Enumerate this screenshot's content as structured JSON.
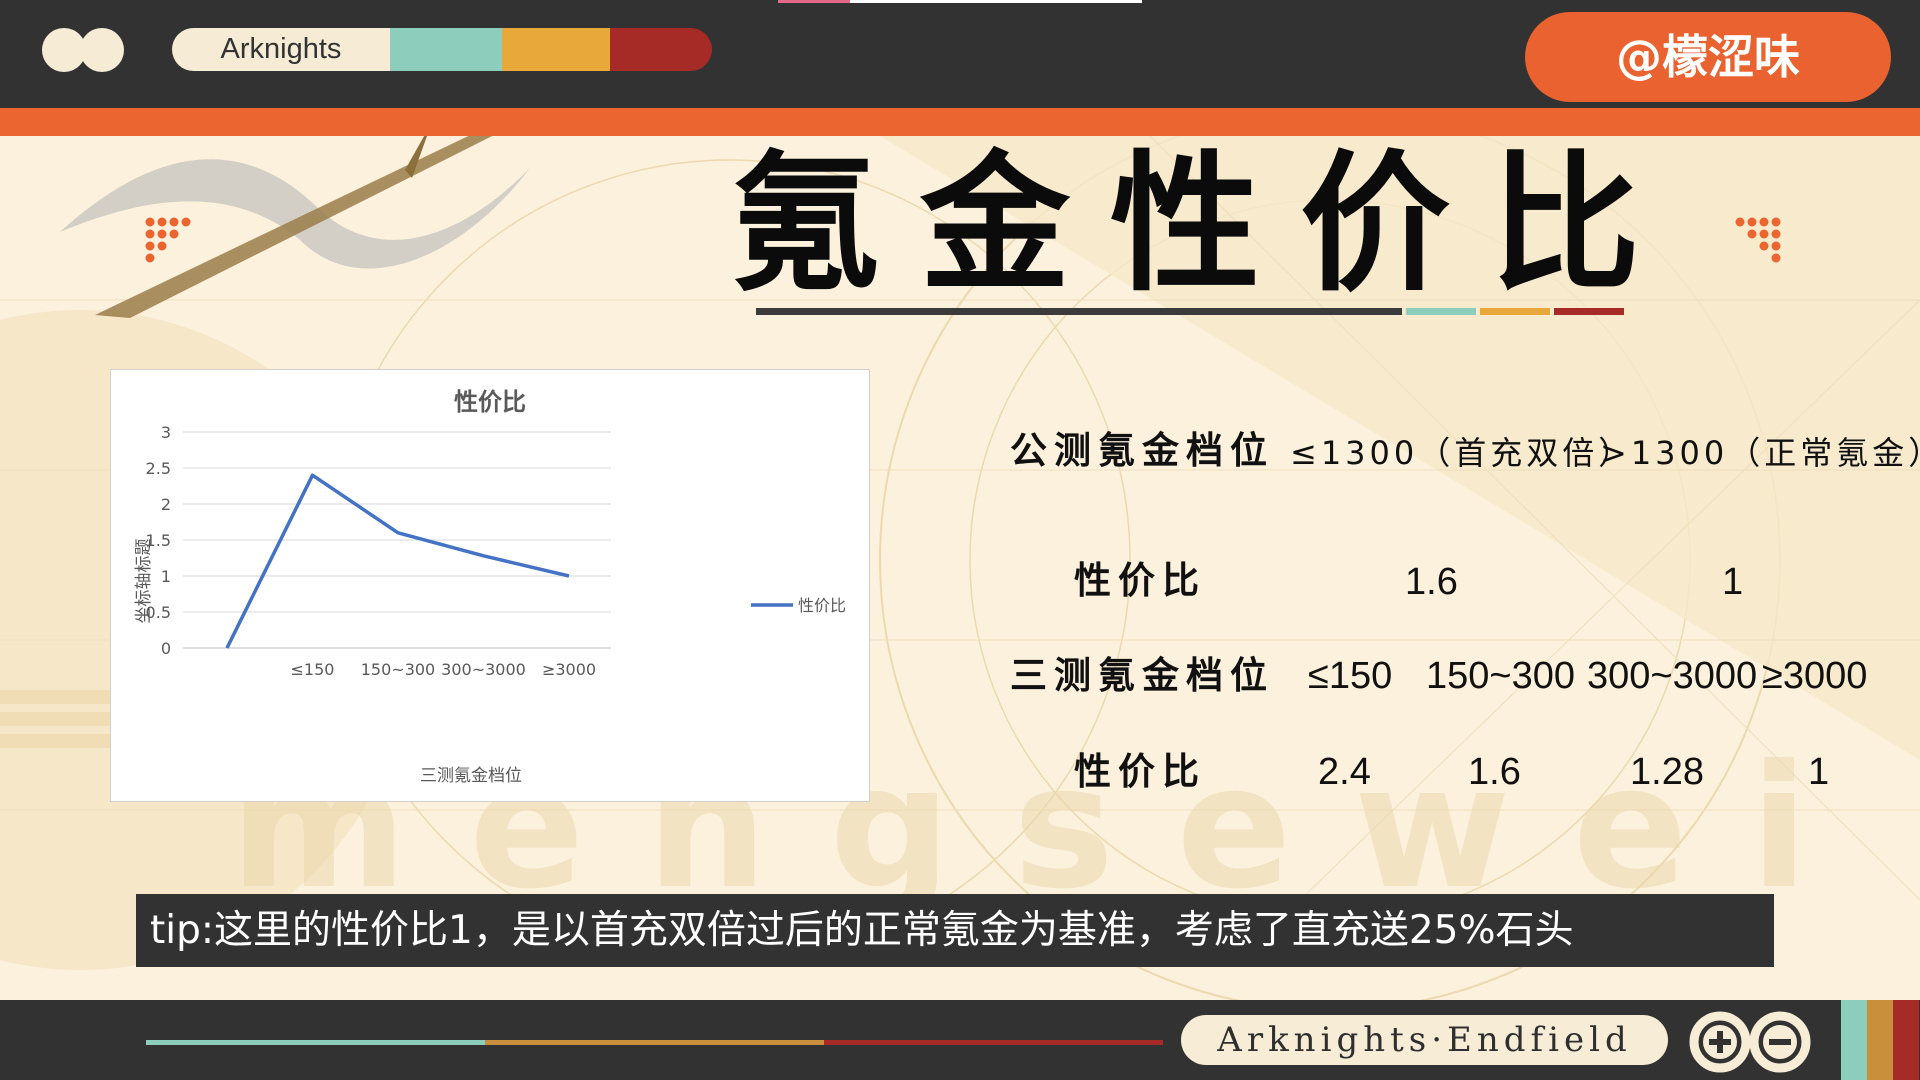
{
  "header": {
    "brand": "Arknights",
    "user": "@檬涩味",
    "pill_colors": [
      "#f6ecd6",
      "#8dcdbb",
      "#e9a93a",
      "#a62a26"
    ]
  },
  "title": {
    "text": "氪金性价比",
    "underline_colors": [
      "#3b3b3b",
      "#8dcdbb",
      "#e9a93a",
      "#a62a26"
    ]
  },
  "table": {
    "row1": {
      "label": "公测氪金档位",
      "col1": "≤1300（首充双倍）",
      "col2": ">1300（正常氪金）"
    },
    "row2": {
      "label": "性价比",
      "col1": "1.6",
      "col2": "1"
    },
    "row3": {
      "label": "三测氪金档位",
      "cols": [
        "≤150",
        "150~300",
        "300~3000",
        "≥3000"
      ]
    },
    "row4": {
      "label": "性价比",
      "cols": [
        "2.4",
        "1.6",
        "1.28",
        "1"
      ]
    }
  },
  "chart_data": {
    "type": "line",
    "title": "性价比",
    "xlabel": "三测氪金档位",
    "ylabel": "坐标轴标题",
    "categories": [
      "",
      "≤150",
      "150~300",
      "300~3000",
      "≥3000"
    ],
    "series": [
      {
        "name": "性价比",
        "values": [
          0,
          2.4,
          1.6,
          1.28,
          1
        ],
        "color": "#4472c4"
      }
    ],
    "ylim": [
      0,
      3
    ],
    "yticks": [
      "0",
      "0.5",
      "1",
      "1.5",
      "2",
      "2.5",
      "3"
    ],
    "grid": true,
    "legend": "right"
  },
  "tip": "tip:这里的性价比1，是以首充双倍过后的正常氪金为基准，考虑了直充送25%石头",
  "footer": {
    "game_name": "Arknights·Endfield",
    "line_colors": [
      "#8dcdbb",
      "#c98f3a",
      "#a62a26"
    ],
    "stripe_colors": [
      "#8dcdbb",
      "#c98f3a",
      "#a62a26"
    ]
  },
  "watermark": "mengsewei"
}
